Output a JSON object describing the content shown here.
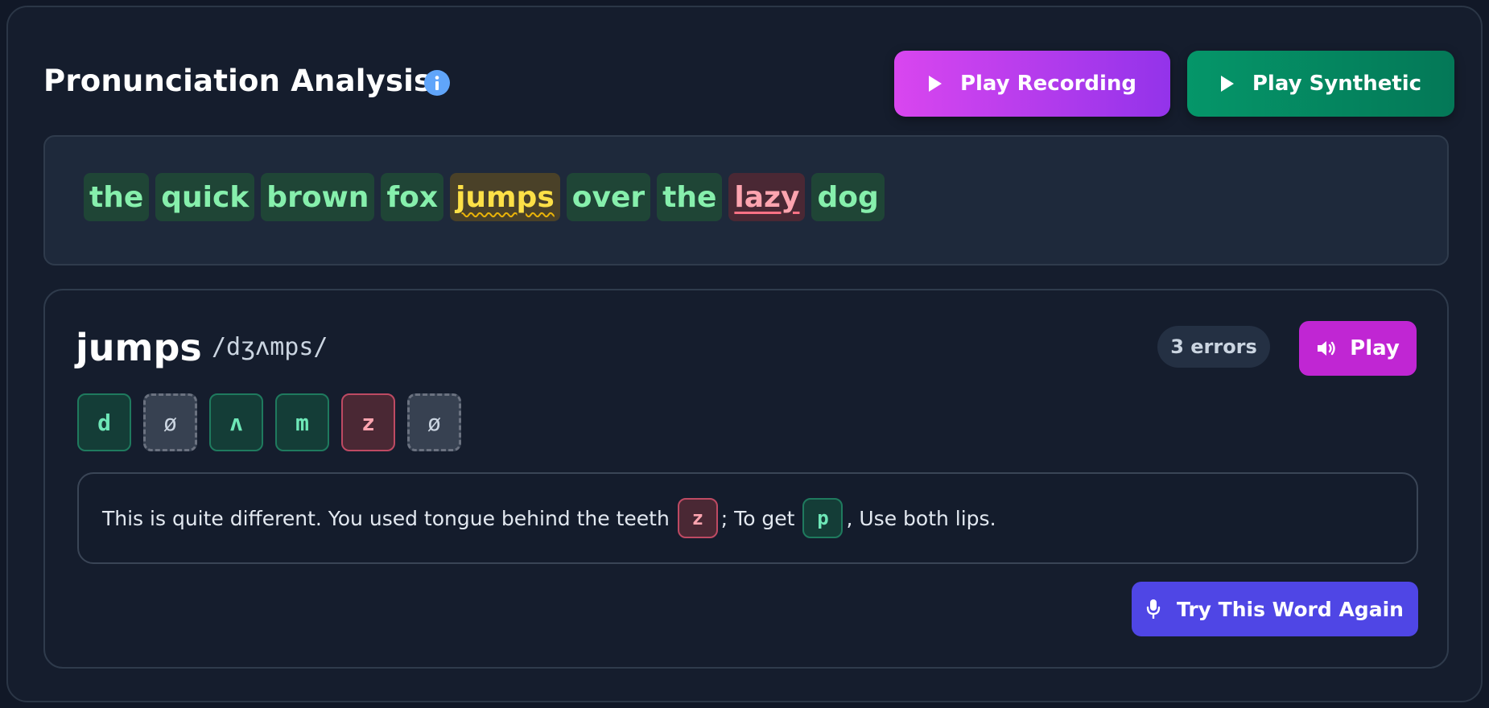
{
  "header": {
    "title": "Pronunciation Analysis",
    "play_recording_label": "Play Recording",
    "play_synthetic_label": "Play Synthetic"
  },
  "sentence": {
    "words": [
      {
        "text": "the",
        "status": "ok"
      },
      {
        "text": "quick",
        "status": "ok"
      },
      {
        "text": "brown",
        "status": "ok"
      },
      {
        "text": "fox",
        "status": "ok"
      },
      {
        "text": "jumps",
        "status": "warn"
      },
      {
        "text": "over",
        "status": "ok"
      },
      {
        "text": "the",
        "status": "ok"
      },
      {
        "text": "lazy",
        "status": "err"
      },
      {
        "text": "dog",
        "status": "ok"
      }
    ]
  },
  "detail": {
    "word": "jumps",
    "ipa": "/dʒʌmps/",
    "errors_badge": "3 errors",
    "play_label": "Play",
    "phonemes": [
      {
        "symbol": "d",
        "status": "ok"
      },
      {
        "symbol": "ø",
        "status": "missing"
      },
      {
        "symbol": "ʌ",
        "status": "ok"
      },
      {
        "symbol": "m",
        "status": "ok"
      },
      {
        "symbol": "z",
        "status": "err"
      },
      {
        "symbol": "ø",
        "status": "missing"
      }
    ],
    "feedback": {
      "part1": "This is quite different. You used tongue behind the teeth",
      "chip1": "z",
      "part2": "; To get",
      "chip2": "p",
      "part3": ", Use both lips."
    },
    "try_again_label": "Try This Word Again"
  },
  "colors": {
    "accent_magenta": "#c026d3",
    "accent_green": "#059669",
    "accent_indigo": "#4f46e5",
    "ok_text": "#86efac",
    "warn_text": "#fde047",
    "error_text": "#fda4af"
  },
  "icons": [
    "info-icon",
    "play-icon",
    "speaker-icon",
    "microphone-icon"
  ]
}
